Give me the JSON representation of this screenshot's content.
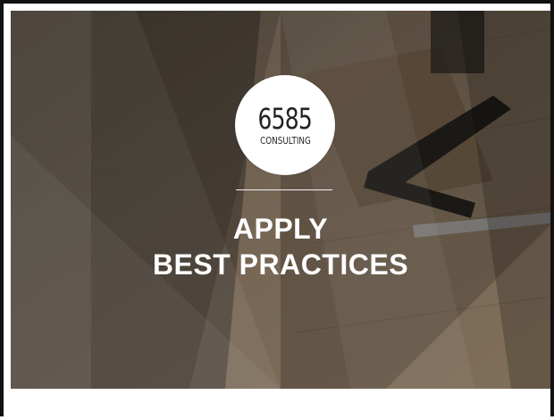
{
  "logo": {
    "number": "6585",
    "subtitle": "CONSULTING"
  },
  "headline": {
    "line1": "APPLY",
    "line2": "BEST PRACTICES"
  },
  "colors": {
    "overlay": "#2b2622",
    "text": "#ffffff",
    "logo_bg": "#ffffff",
    "logo_text": "#222222"
  }
}
